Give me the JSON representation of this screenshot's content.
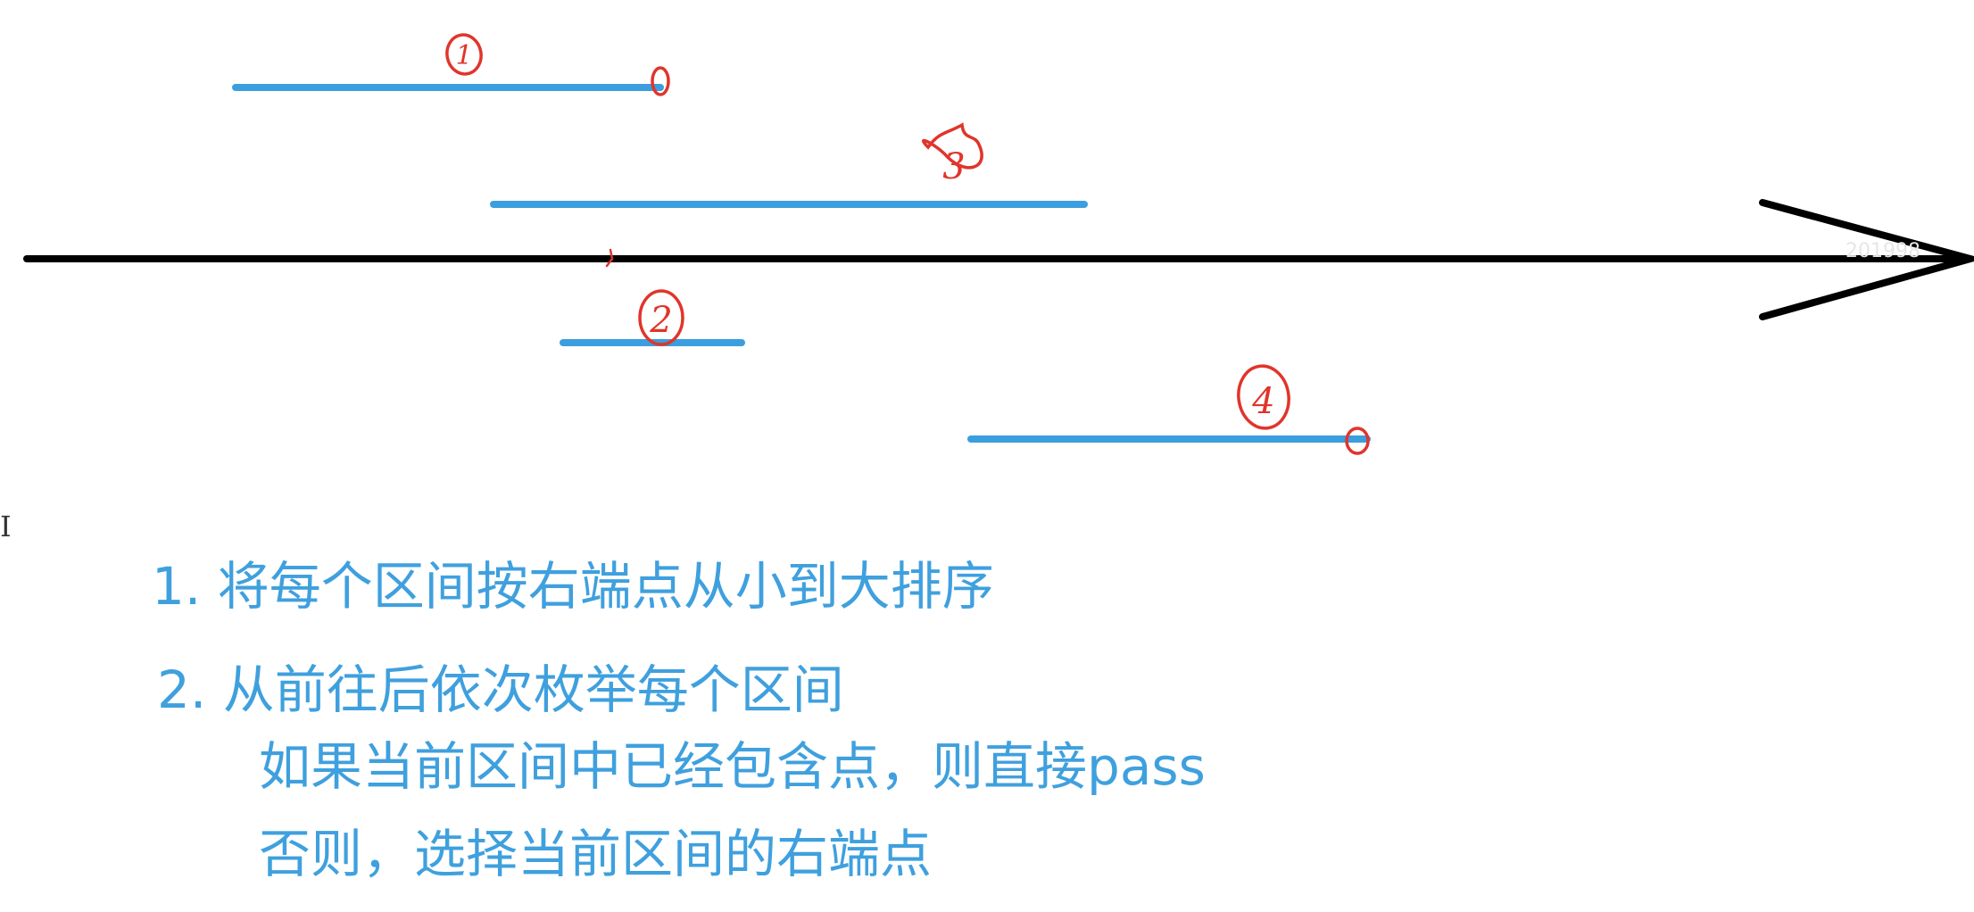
{
  "diagram": {
    "intervals": [
      {
        "id": "interval-1",
        "label": "1"
      },
      {
        "id": "interval-3",
        "label": "3"
      },
      {
        "id": "interval-2",
        "label": "2"
      },
      {
        "id": "interval-4",
        "label": "4"
      }
    ],
    "watermark": "201998",
    "colors": {
      "axis": "#000000",
      "interval": "#3b9ede",
      "annotation": "#e0352b",
      "text": "#3fa0de"
    }
  },
  "steps": {
    "step1": "1. 将每个区间按右端点从小到大排序",
    "step2": "2. 从前往后依次枚举每个区间",
    "step2a": "如果当前区间中已经包含点，则直接pass",
    "step2b": "否则，选择当前区间的右端点"
  },
  "cursor_glyph": "I"
}
